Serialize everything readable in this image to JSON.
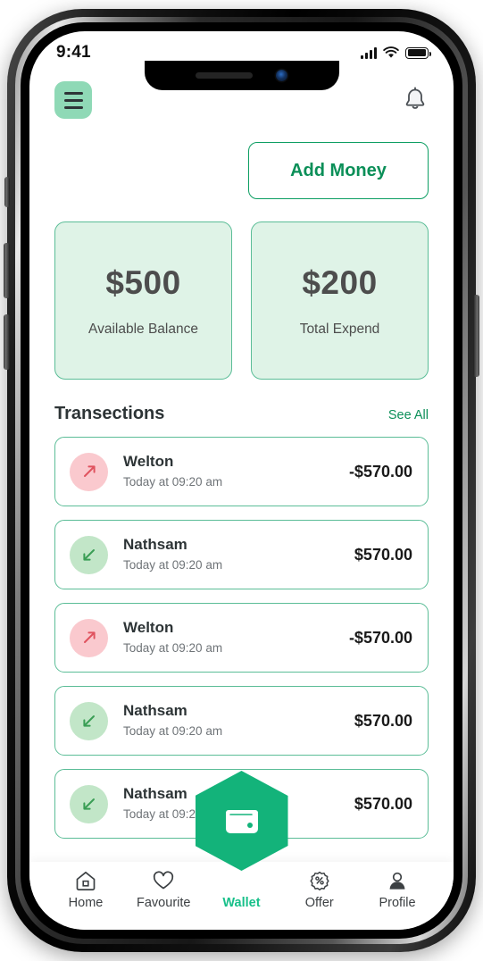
{
  "status_bar": {
    "time": "9:41",
    "signal_icon": "signal-bars-icon",
    "wifi_icon": "wifi-icon",
    "battery_icon": "battery-full-icon"
  },
  "header": {
    "menu_icon": "hamburger-menu-icon",
    "notification_icon": "bell-icon"
  },
  "actions": {
    "add_money_label": "Add Money"
  },
  "balance": {
    "cards": [
      {
        "amount": "$500",
        "label": "Available Balance"
      },
      {
        "amount": "$200",
        "label": "Total Expend"
      }
    ]
  },
  "transactions": {
    "title": "Transections",
    "see_all_label": "See All",
    "items": [
      {
        "name": "Welton",
        "time": "Today at 09:20 am",
        "amount": "-$570.00",
        "direction": "out"
      },
      {
        "name": "Nathsam",
        "time": "Today at 09:20 am",
        "amount": "$570.00",
        "direction": "in"
      },
      {
        "name": "Welton",
        "time": "Today at 09:20 am",
        "amount": "-$570.00",
        "direction": "out"
      },
      {
        "name": "Nathsam",
        "time": "Today at 09:20 am",
        "amount": "$570.00",
        "direction": "in"
      },
      {
        "name": "Nathsam",
        "time": "Today at 09:20 am",
        "amount": "$570.00",
        "direction": "in"
      }
    ]
  },
  "bottom_nav": {
    "fab_icon": "wallet-icon",
    "items": [
      {
        "label": "Home",
        "icon": "home-icon",
        "active": false
      },
      {
        "label": "Favourite",
        "icon": "heart-icon",
        "active": false
      },
      {
        "label": "Wallet",
        "icon": "wallet-icon",
        "active": true
      },
      {
        "label": "Offer",
        "icon": "percent-badge-icon",
        "active": false
      },
      {
        "label": "Profile",
        "icon": "person-icon",
        "active": false
      }
    ]
  },
  "colors": {
    "brand_green": "#13b37a",
    "accent_green": "#0b8f58",
    "active_green": "#18c08a",
    "card_mint": "#dff3e7",
    "menu_mint": "#8fd9b6",
    "out_pink": "#fac9ce",
    "in_green": "#c2e6c8",
    "out_arrow": "#e0535f",
    "in_arrow": "#3a9e55"
  }
}
